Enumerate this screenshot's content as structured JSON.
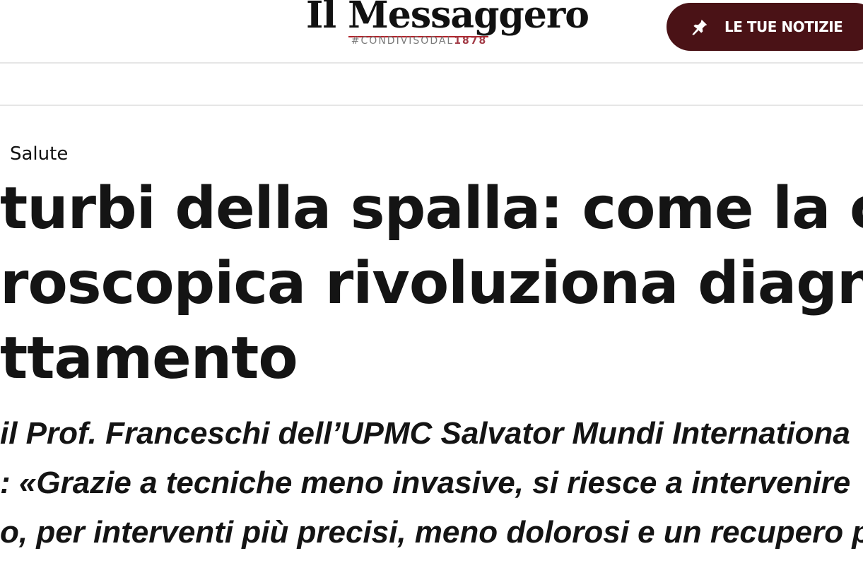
{
  "header": {
    "logo_title": "Il Messaggero",
    "logo_tagline_prefix": "#CONDIVISODAL",
    "logo_tagline_year": "1878",
    "news_button_label": "LE TUE NOTIZIE",
    "news_button_icon": "pin-icon"
  },
  "article": {
    "section": "Salute",
    "headline_lines": [
      "turbi della spalla: come la chir",
      "roscopica rivoluziona diagnos",
      "ttamento"
    ],
    "subheadline_lines": [
      "il Prof. Franceschi dell’UPMC Salvator Mundi Internationa",
      ": «Grazie a tecniche meno invasive, si riesce a intervenire",
      "o, per interventi più precisi, meno dolorosi e un recupero pi"
    ]
  },
  "colors": {
    "button_bg": "#4a1216",
    "logo_accent": "#b0232a",
    "tagline_year": "#a23a45"
  }
}
